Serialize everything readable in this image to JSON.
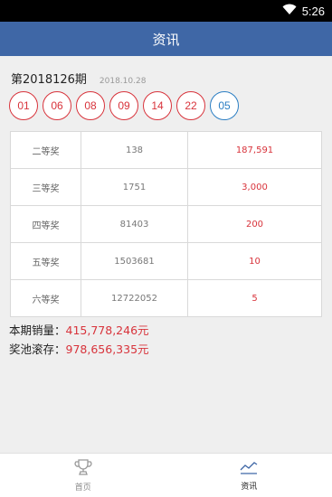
{
  "status_bar": {
    "time": "5:26",
    "wifi_icon": "wifi-icon"
  },
  "header": {
    "title": "资讯"
  },
  "draw": {
    "number": "第2018126期",
    "date": "2018.10.28",
    "red_balls": [
      "01",
      "06",
      "08",
      "09",
      "14",
      "22"
    ],
    "blue_ball": "05"
  },
  "prizes": [
    {
      "level": "二等奖",
      "winners": "138",
      "amount": "187,591"
    },
    {
      "level": "三等奖",
      "winners": "1751",
      "amount": "3,000"
    },
    {
      "level": "四等奖",
      "winners": "81403",
      "amount": "200"
    },
    {
      "level": "五等奖",
      "winners": "1503681",
      "amount": "10"
    },
    {
      "level": "六等奖",
      "winners": "12722052",
      "amount": "5"
    }
  ],
  "summary": {
    "sales_label": "本期销量：",
    "sales_value": "415,778,246元",
    "pool_label": "奖池滚存：",
    "pool_value": "978,656,335元"
  },
  "tabs": [
    {
      "label": "首页",
      "icon": "trophy-icon"
    },
    {
      "label": "资讯",
      "icon": "trend-chart-icon"
    }
  ],
  "colors": {
    "header": "#3f67a6",
    "red": "#d8333b",
    "blue": "#2b7ec3"
  }
}
